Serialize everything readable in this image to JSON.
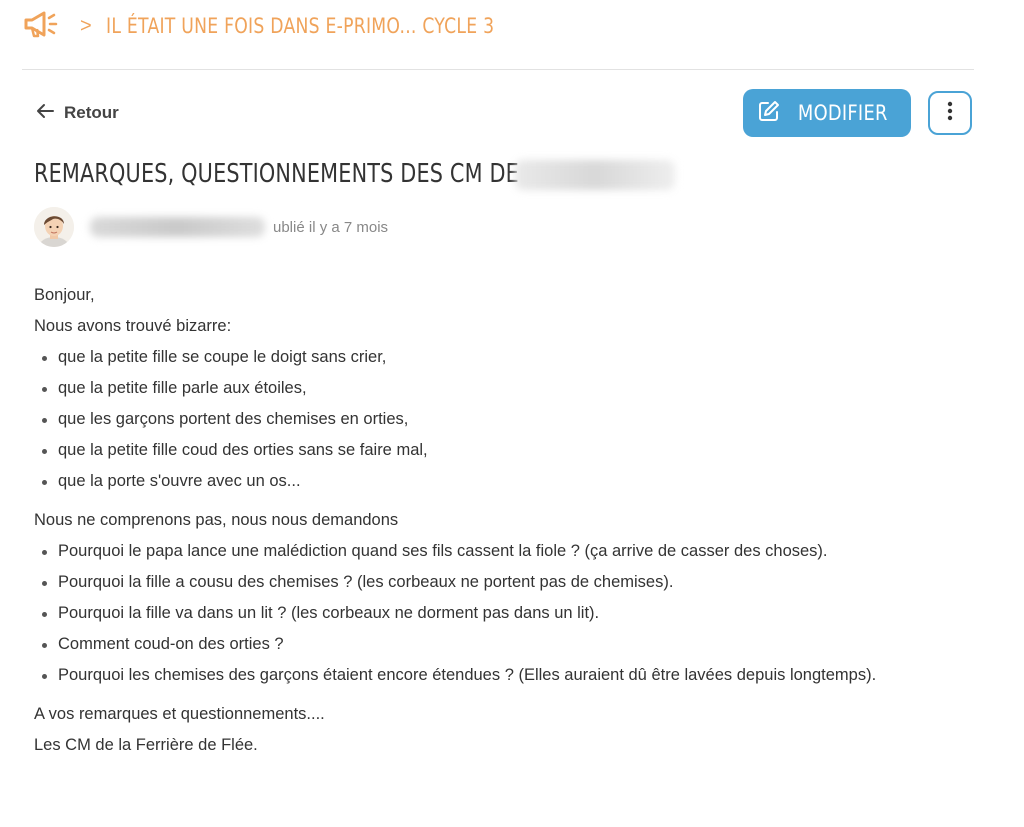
{
  "breadcrumb": {
    "icon": "megaphone-icon",
    "separator": ">",
    "title": "IL ÉTAIT UNE FOIS DANS E-PRIMO... CYCLE 3"
  },
  "toolbar": {
    "back_label": "Retour",
    "modify_label": "MODIFIER",
    "more_icon": "more-vertical-icon"
  },
  "post": {
    "title": "REMARQUES, QUESTIONNEMENTS DES CM DE",
    "published": "ublié il y a 7 mois"
  },
  "content": {
    "greeting": "Bonjour,",
    "intro1": "Nous avons trouvé bizarre:",
    "list1": [
      "que la petite fille se coupe le doigt sans crier,",
      "que la petite fille parle aux étoiles,",
      "que les garçons portent des chemises en orties,",
      "que la petite fille coud des orties sans se faire mal,",
      "que la porte s'ouvre avec un os..."
    ],
    "intro2": "Nous ne comprenons pas, nous nous demandons",
    "list2": [
      "Pourquoi le papa lance une malédiction quand ses fils cassent la fiole ? (ça arrive de casser des choses).",
      "Pourquoi la fille a cousu des chemises ? (les corbeaux ne portent pas de chemises).",
      "Pourquoi la fille va dans un lit ? (les corbeaux ne dorment pas dans un lit).",
      "Comment coud-on des orties ?",
      "Pourquoi les chemises des garçons étaient encore étendues ? (Elles auraient dû être lavées depuis longtemps)."
    ],
    "closing1": "A vos remarques et questionnements....",
    "closing2": "Les CM de la Ferrière de Flée."
  },
  "colors": {
    "accent_orange": "#f0a35a",
    "button_blue": "#4aa3d6"
  }
}
